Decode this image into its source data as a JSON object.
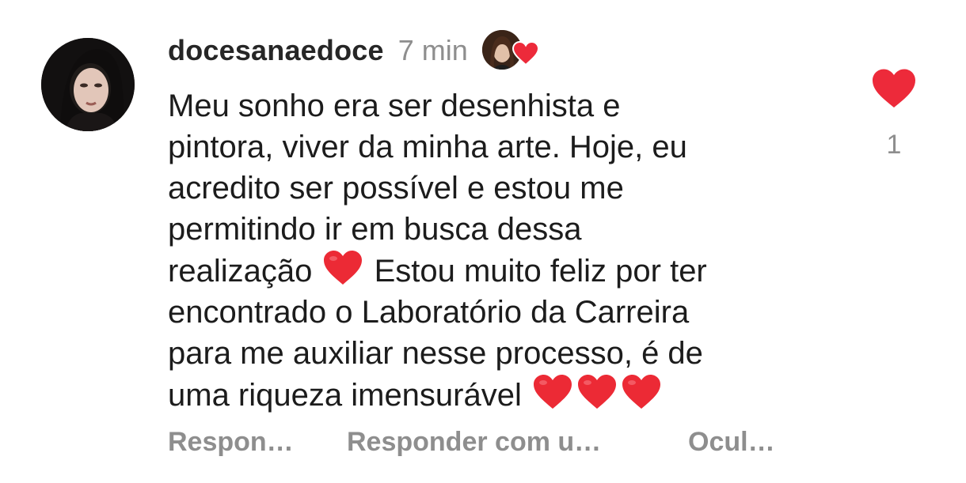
{
  "comment": {
    "username": "docesanaedoce",
    "time": "7 min",
    "avatar_icon": "user-photo-avatar",
    "liked_by_icon": "creator-avatar-with-heart",
    "text_lines": [
      "Meu sonho era ser desenhista e",
      "pintora, viver da minha arte. Hoje, eu",
      "acredito ser possível e estou me",
      "permitindo ir em busca dessa",
      "realização",
      "Estou muito feliz por ter",
      "encontrado o Laboratório da Carreira",
      "para me auxiliar nesse processo, é de",
      "uma riqueza imensurável"
    ],
    "like_count": "1",
    "like_icon": "heart-filled-icon",
    "heart_color": "#ed2a3a"
  },
  "actions": {
    "reply": "Respon…",
    "reply_with": "Responder com u…",
    "hide": "Ocul…"
  }
}
